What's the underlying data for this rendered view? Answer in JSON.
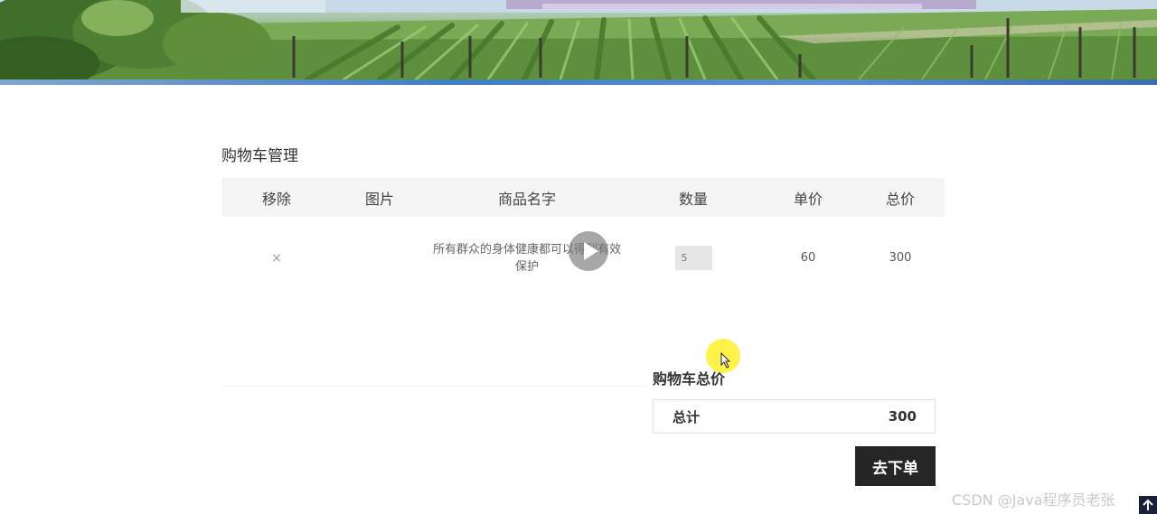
{
  "page": {
    "section_title": "购物车管理"
  },
  "table": {
    "headers": {
      "remove": "移除",
      "image": "图片",
      "name": "商品名字",
      "quantity": "数量",
      "unit_price": "单价",
      "total_price": "总价"
    },
    "rows": [
      {
        "remove": "×",
        "name": "所有群众的身体健康都可以得到有效保护",
        "quantity": "5",
        "unit_price": "60",
        "total_price": "300"
      }
    ]
  },
  "totals": {
    "title": "购物车总价",
    "label": "总计",
    "value": "300"
  },
  "actions": {
    "checkout_label": "去下单"
  },
  "overlay": {
    "play_icon": "play-icon",
    "cursor_icon": "cursor-arrow-icon",
    "back_top_icon": "arrow-up-icon"
  },
  "watermark": "CSDN @Java程序员老张",
  "colors": {
    "header_bg": "#f5f5f5",
    "button_bg": "#262626",
    "qty_bg": "#e6e6e6",
    "cursor_highlight": "#fff028"
  }
}
